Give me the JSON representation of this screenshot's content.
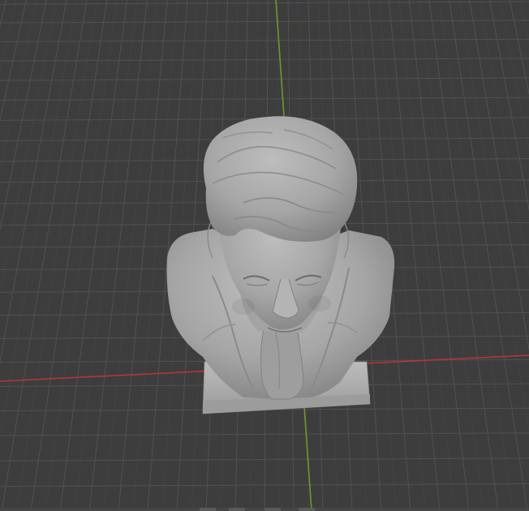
{
  "viewport": {
    "background_color": "#3d3d3d",
    "grid_color": "#515151",
    "grid_fine_color": "#474747",
    "x_axis_color": "#b3363c",
    "y_axis_color": "#6f9a25",
    "model": {
      "name": "bust",
      "color": "#a8a8a8"
    },
    "icons": [
      "viewport-grid",
      "x-axis-line",
      "y-axis-line",
      "sculpted-bust-model"
    ]
  }
}
